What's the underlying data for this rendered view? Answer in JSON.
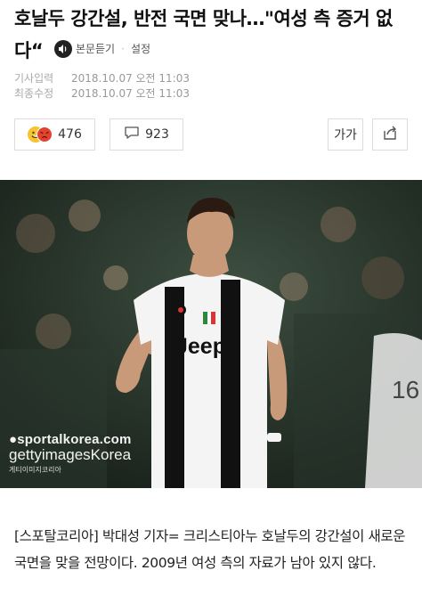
{
  "article": {
    "headline": "호날두 강간설, 반전 국면 맞나…\"여성 측 증거 없다“",
    "listen_label": "본문듣기",
    "settings_label": "설정",
    "meta": [
      {
        "label": "기사입력",
        "value": "2018.10.07 오전 11:03"
      },
      {
        "label": "최종수정",
        "value": "2018.10.07 오전 11:03"
      }
    ],
    "reactions_count": "476",
    "comments_count": "923",
    "font_size_label": "가가",
    "photo": {
      "watermark_line1": "●sportalkorea.com",
      "watermark_line2": "gettyimagesKorea",
      "watermark_line3": "게티이미지코리아"
    },
    "body": "[스포탈코리아] 박대성 기자= 크리스티아누 호날두의 강간설이 새로운 국면을 맞을 전망이다. 2009년 여성 측의 자료가 남아 있지 않다."
  },
  "colors": {
    "jersey_white": "#f4f4f4",
    "jersey_black": "#111111",
    "crowd_bg": "#24332a"
  },
  "icons": [
    "speaker-icon",
    "emoji-happy-icon",
    "emoji-angry-icon",
    "comment-icon",
    "share-icon"
  ]
}
